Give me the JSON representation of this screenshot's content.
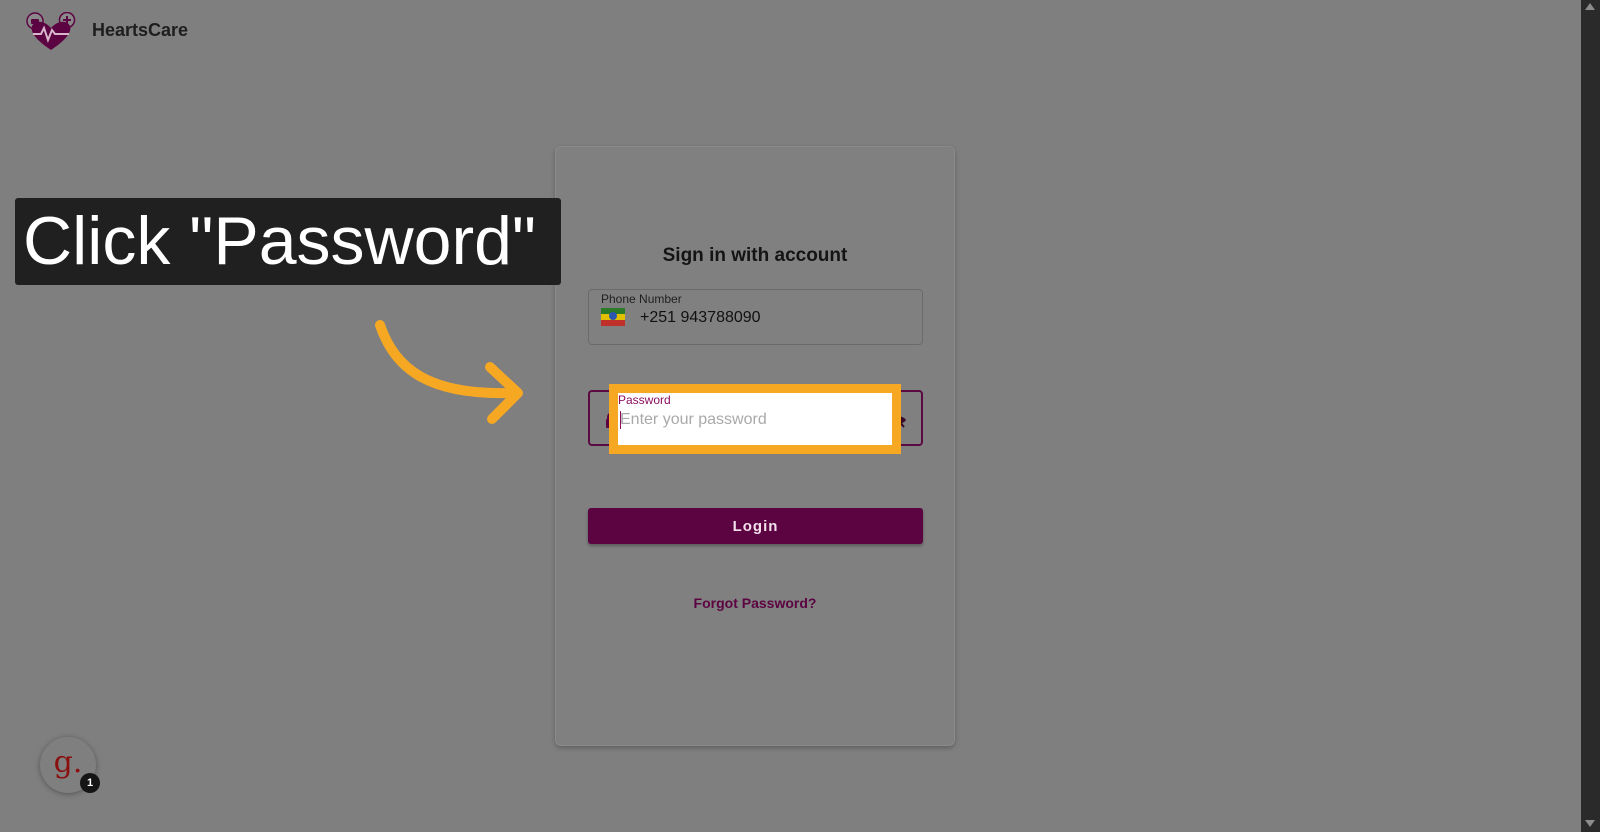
{
  "header": {
    "brand": "HeartsCare",
    "logo_icon": "heart-pulse-logo-icon"
  },
  "login_card": {
    "title": "Sign in with account",
    "phone": {
      "label": "Phone Number",
      "value": "+251 943788090",
      "flag_icon": "ethiopia-flag-icon"
    },
    "password": {
      "label": "Password",
      "placeholder": "Enter your password",
      "value": "",
      "lock_icon": "lock-icon",
      "visibility_icon": "eye-off-icon"
    },
    "login_button": "Login",
    "forgot_link": "Forgot Password?"
  },
  "guide": {
    "instruction": "Click \"Password\"",
    "highlight_color": "#f7a823",
    "badge_count": "1",
    "widget_letter": "g."
  },
  "colors": {
    "brand_primary": "#5c0442",
    "accent_label": "#8a0e60",
    "overlay_background": "#7f7f7f"
  }
}
